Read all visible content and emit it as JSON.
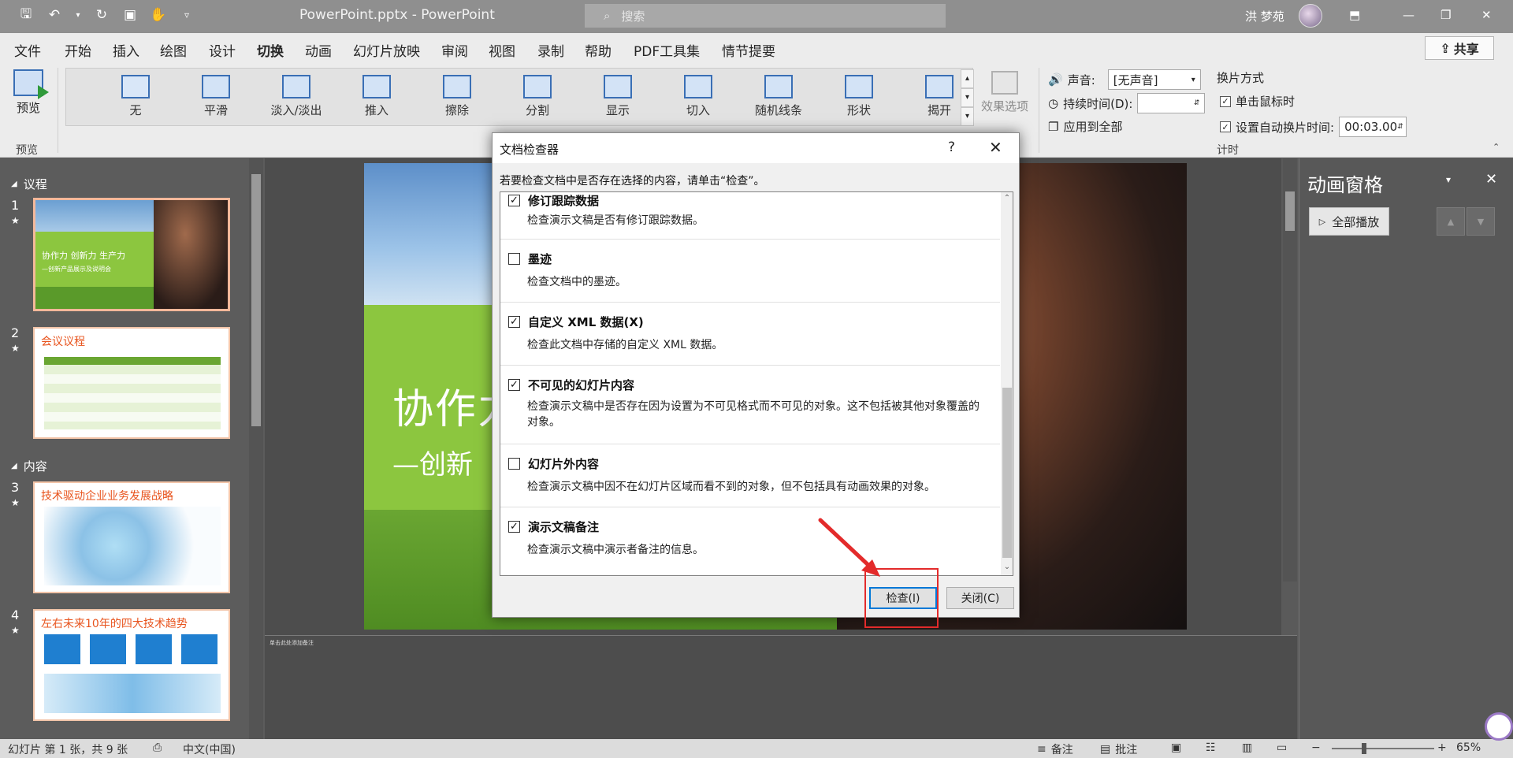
{
  "titlebar": {
    "doc_title": "PowerPoint.pptx - PowerPoint",
    "search_placeholder": "搜索",
    "user_name": "洪 梦苑"
  },
  "tabs": [
    "文件",
    "开始",
    "插入",
    "绘图",
    "设计",
    "切换",
    "动画",
    "幻灯片放映",
    "审阅",
    "视图",
    "录制",
    "帮助",
    "PDF工具集",
    "情节提要"
  ],
  "active_tab": "切换",
  "share_label": "共享",
  "ribbon": {
    "preview_label": "预览",
    "preview_group": "预览",
    "transitions": [
      "无",
      "平滑",
      "淡入/淡出",
      "推入",
      "擦除",
      "分割",
      "显示",
      "切入",
      "随机线条",
      "形状",
      "揭开"
    ],
    "effect_options": "效果选项",
    "sound_label": "声音:",
    "sound_value": "[无声音]",
    "duration_label": "持续时间(D):",
    "apply_all": "应用到全部",
    "advance_label": "换片方式",
    "on_click": "单击鼠标时",
    "auto_after": "设置自动换片时间:",
    "auto_time": "00:03.00",
    "timing_group": "计时"
  },
  "thumbnails": {
    "sections": [
      "议程",
      "内容"
    ],
    "slides": [
      {
        "num": "1",
        "title": "协作力  创新力  生产力",
        "subtitle": "—创新产品展示及说明会"
      },
      {
        "num": "2",
        "title": "会议议程"
      },
      {
        "num": "3",
        "title": "技术驱动企业业务发展战略"
      },
      {
        "num": "4",
        "title": "左右未来10年的四大技术趋势"
      }
    ]
  },
  "slide": {
    "title": "协作力",
    "subtitle": "—创新"
  },
  "notes_text": "单击此处添加备注",
  "anim_pane": {
    "title": "动画窗格",
    "play_all": "全部播放"
  },
  "statusbar": {
    "slide_info": "幻灯片 第 1 张，共 9 张",
    "language": "中文(中国)",
    "notes": "备注",
    "comments": "批注",
    "zoom": "65%"
  },
  "dialog": {
    "title": "文档检查器",
    "help": "?",
    "instruction": "若要检查文档中是否存在选择的内容，请单击“检查”。",
    "items": [
      {
        "label": "修订跟踪数据",
        "desc": "检查演示文稿是否有修订跟踪数据。",
        "checked": true
      },
      {
        "label": "墨迹",
        "desc": "检查文档中的墨迹。",
        "checked": false
      },
      {
        "label": "自定义 XML 数据(X)",
        "desc": "检查此文档中存储的自定义 XML 数据。",
        "checked": true
      },
      {
        "label": "不可见的幻灯片内容",
        "desc": "检查演示文稿中是否存在因为设置为不可见格式而不可见的对象。这不包括被其他对象覆盖的对象。",
        "checked": true
      },
      {
        "label": "幻灯片外内容",
        "desc": "检查演示文稿中因不在幻灯片区域而看不到的对象，但不包括具有动画效果的对象。",
        "checked": false
      },
      {
        "label": "演示文稿备注",
        "desc": "检查演示文稿中演示者备注的信息。",
        "checked": true
      }
    ],
    "inspect_button": "检查(I)",
    "close_button": "关闭(C)"
  },
  "colors": {
    "titlebar": "#8f8f8f",
    "highlight": "#e32b2b",
    "accent": "#0078d7"
  }
}
